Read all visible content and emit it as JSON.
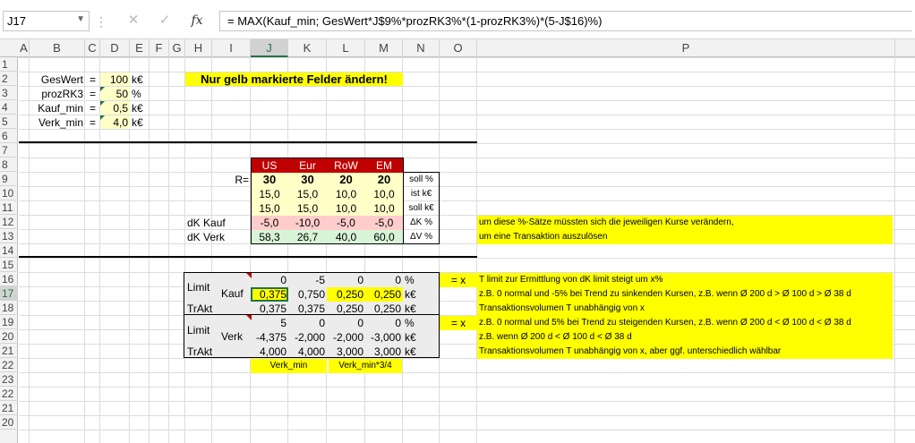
{
  "formula_bar": {
    "name_box": "J17",
    "cancel_icon": "✕",
    "enter_icon": "✓",
    "fx_label": "fx",
    "formula": "= MAX(Kauf_min; GesWert*J$9%*prozRK3%*(1-prozRK3%)*(5-J$16)%)"
  },
  "columns": [
    "A",
    "B",
    "C",
    "D",
    "E",
    "F",
    "G",
    "H",
    "I",
    "J",
    "K",
    "L",
    "M",
    "N",
    "O",
    "P"
  ],
  "rows": [
    "1",
    "2",
    "3",
    "4",
    "5",
    "6",
    "7",
    "8",
    "9",
    "10",
    "11",
    "12",
    "13",
    "14",
    "15",
    "16",
    "17",
    "18",
    "19",
    "20",
    "21",
    "22",
    "23",
    "22",
    "21",
    "20"
  ],
  "params": {
    "geswert_label": "GesWert",
    "geswert_eq": "=",
    "geswert_val": "100",
    "geswert_unit": "k€",
    "prozrk3_label": "prozRK3",
    "prozrk3_eq": "=",
    "prozrk3_val": "50",
    "prozrk3_unit": "%",
    "kaufmin_label": "Kauf_min",
    "kaufmin_eq": "=",
    "kaufmin_val": "0,5",
    "kaufmin_unit": "k€",
    "verkmin_label": "Verk_min",
    "verkmin_eq": "=",
    "verkmin_val": "4,0",
    "verkmin_unit": "k€"
  },
  "banner": "Nur gelb markierte Felder ändern!",
  "table1": {
    "r_label": "R=",
    "headers": [
      "US",
      "Eur",
      "RoW",
      "EM"
    ],
    "soll_pct": [
      "30",
      "30",
      "20",
      "20"
    ],
    "ist": [
      "15,0",
      "15,0",
      "10,0",
      "10,0"
    ],
    "soll_k": [
      "15,0",
      "15,0",
      "10,0",
      "10,0"
    ],
    "dk_kauf_label": "dK Kauf",
    "dk_kauf": [
      "-5,0",
      "-10,0",
      "-5,0",
      "-5,0"
    ],
    "dk_verk_label": "dK Verk",
    "dk_verk": [
      "58,3",
      "26,7",
      "40,0",
      "60,0"
    ],
    "unit_soll_pct": "soll %",
    "unit_ist": "ist k€",
    "unit_soll_k": "soll k€",
    "unit_dk": "ΔK %",
    "unit_dv": "ΔV %",
    "note1": "um diese %-Sätze müssten sich die jeweiligen Kurse verändern,",
    "note2": "um eine Transaktion auszulösen"
  },
  "table2": {
    "limit_label": "Limit",
    "kauf_label": "Kauf",
    "trakt_label": "TrAkt",
    "verk_label": "Verk",
    "kauf_limit": [
      "0",
      "-5",
      "0",
      "0"
    ],
    "kauf_vals": [
      "0,375",
      "0,750",
      "0,250",
      "0,250"
    ],
    "kauf_trakt": [
      "0,375",
      "0,375",
      "0,250",
      "0,250"
    ],
    "verk_limit": [
      "5",
      "0",
      "0",
      "0"
    ],
    "verk_vals": [
      "-4,375",
      "-2,000",
      "-2,000",
      "-3,000"
    ],
    "verk_trakt": [
      "4,000",
      "4,000",
      "3,000",
      "3,000"
    ],
    "u_pct": "%",
    "u_k": "k€",
    "eqx": "= x",
    "verk_min_label": "Verk_min",
    "verk_min34_label": "Verk_min*3/4",
    "note16": "T limit zur Ermittlung von dK limit steigt um x%",
    "note17": "z.B. 0 normal und -5% bei Trend zu sinkenden Kursen, z.B. wenn Ø 200 d > Ø 100 d  > Ø 38 d",
    "note18": "Transaktionsvolumen T unabhängig von x",
    "note19": "z.B. 0 normal und 5% bei Trend zu steigenden Kursen, z.B. wenn Ø 200 d < Ø 100 d  < Ø 38 d",
    "note20": "z.B. wenn Ø 200 d < Ø 100 d  < Ø 38 d",
    "note21": "Transaktionsvolumen T unabhängig von x, aber ggf. unterschiedlich wählbar"
  }
}
